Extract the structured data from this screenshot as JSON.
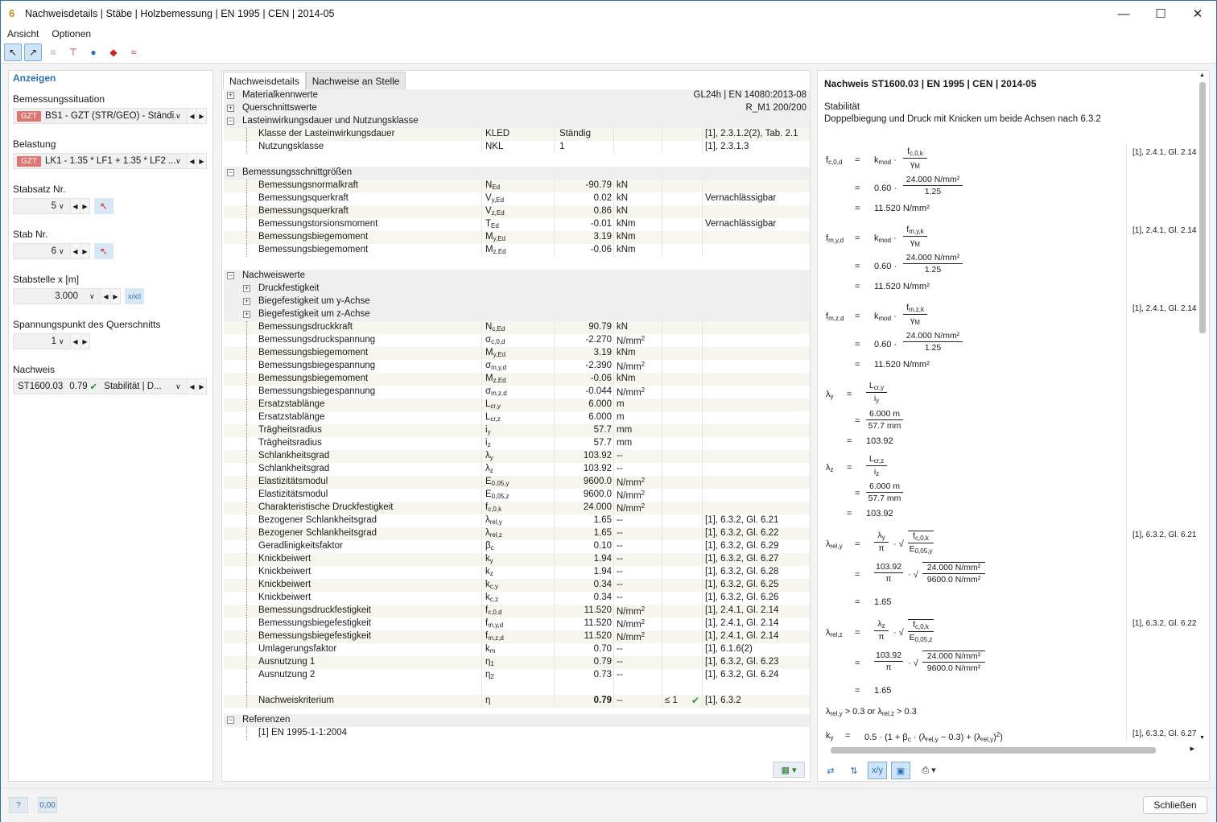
{
  "window": {
    "title": "Nachweisdetails | Stäbe | Holzbemessung | EN 1995 | CEN | 2014-05",
    "app_icon": "timber-app-icon",
    "colors": {
      "accent": "#2b6fb8",
      "gzt_badge": "#e0756f",
      "check_ok": "#1b9a3a"
    }
  },
  "menu": [
    "Ansicht",
    "Optionen"
  ],
  "left": {
    "header": "Anzeigen",
    "bemessungssituation_label": "Bemessungssituation",
    "bemessungssituation_badge": "GZT",
    "bemessungssituation_value": "BS1 - GZT (STR/GEO) - Ständi...",
    "belastung_label": "Belastung",
    "belastung_badge": "GZT",
    "belastung_value": "LK1 - 1.35 * LF1 + 1.35 * LF2 ...",
    "stabsatz_label": "Stabsatz Nr.",
    "stabsatz_value": "5",
    "stab_label": "Stab Nr.",
    "stab_value": "6",
    "stabstelle_label": "Stabstelle x [m]",
    "stabstelle_value": "3.000",
    "stabstelle_btn": "x/x",
    "spannungspunkt_label": "Spannungspunkt des Querschnitts",
    "spannungspunkt_value": "1",
    "nachweis_label": "Nachweis",
    "nachweis_id": "ST1600.03",
    "nachweis_ratio": "0.79",
    "nachweis_type": "Stabilität | D..."
  },
  "middle": {
    "tabs": [
      "Nachweisdetails",
      "Nachweise an Stelle"
    ],
    "sections": {
      "material": {
        "label": "Materialkennwerte",
        "right": "GL24h | EN 14080:2013-08"
      },
      "querschnitt": {
        "label": "Querschnittswerte",
        "right": "R_M1 200/200"
      },
      "lastdauer": {
        "label": "Lasteinwirkungsdauer und Nutzungsklasse"
      },
      "schnitt": {
        "label": "Bemessungsschnittgrößen"
      },
      "nachweiswerte": {
        "label": "Nachweiswerte"
      },
      "druckfestigkeit": {
        "label": "Druckfestigkeit"
      },
      "biege_y": {
        "label": "Biegefestigkeit um y-Achse"
      },
      "biege_z": {
        "label": "Biegefestigkeit um z-Achse"
      },
      "referenzen": {
        "label": "Referenzen"
      }
    },
    "lastdauer_rows": [
      {
        "name": "Klasse der Lasteinwirkungsdauer",
        "sym": "KLED",
        "txt": "Ständig",
        "ref": "[1], 2.3.1.2(2), Tab. 2.1"
      },
      {
        "name": "Nutzungsklasse",
        "sym": "NKL",
        "txt": "1",
        "ref": "[1], 2.3.1.3"
      }
    ],
    "schnitt_rows": [
      {
        "name": "Bemessungsnormalkraft",
        "s": "N",
        "sub": "Ed",
        "val": "-90.79",
        "unit": "kN",
        "ref": ""
      },
      {
        "name": "Bemessungsquerkraft",
        "s": "V",
        "sub": "y,Ed",
        "val": "0.02",
        "unit": "kN",
        "ref": "Vernachlässigbar"
      },
      {
        "name": "Bemessungsquerkraft",
        "s": "V",
        "sub": "z,Ed",
        "val": "0.86",
        "unit": "kN",
        "ref": ""
      },
      {
        "name": "Bemessungstorsionsmoment",
        "s": "T",
        "sub": "Ed",
        "val": "-0.01",
        "unit": "kNm",
        "ref": "Vernachlässigbar"
      },
      {
        "name": "Bemessungsbiegemoment",
        "s": "M",
        "sub": "y,Ed",
        "val": "3.19",
        "unit": "kNm",
        "ref": ""
      },
      {
        "name": "Bemessungsbiegemoment",
        "s": "M",
        "sub": "z,Ed",
        "val": "-0.06",
        "unit": "kNm",
        "ref": ""
      }
    ],
    "nachweis_rows": [
      {
        "name": "Bemessungsdruckkraft",
        "s": "N",
        "sub": "c,Ed",
        "val": "90.79",
        "unit": "kN",
        "ref": ""
      },
      {
        "name": "Bemessungsdruckspannung",
        "s": "σ",
        "sub": "c,0,d",
        "val": "-2.270",
        "unit": "N/mm²",
        "ref": ""
      },
      {
        "name": "Bemessungsbiegemoment",
        "s": "M",
        "sub": "y,Ed",
        "val": "3.19",
        "unit": "kNm",
        "ref": ""
      },
      {
        "name": "Bemessungsbiegespannung",
        "s": "σ",
        "sub": "m,y,d",
        "val": "-2.390",
        "unit": "N/mm²",
        "ref": ""
      },
      {
        "name": "Bemessungsbiegemoment",
        "s": "M",
        "sub": "z,Ed",
        "val": "-0.06",
        "unit": "kNm",
        "ref": ""
      },
      {
        "name": "Bemessungsbiegespannung",
        "s": "σ",
        "sub": "m,z,d",
        "val": "-0.044",
        "unit": "N/mm²",
        "ref": ""
      },
      {
        "name": "Ersatzstablänge",
        "s": "L",
        "sub": "cr,y",
        "val": "6.000",
        "unit": "m",
        "ref": ""
      },
      {
        "name": "Ersatzstablänge",
        "s": "L",
        "sub": "cr,z",
        "val": "6.000",
        "unit": "m",
        "ref": ""
      },
      {
        "name": "Trägheitsradius",
        "s": "i",
        "sub": "y",
        "val": "57.7",
        "unit": "mm",
        "ref": ""
      },
      {
        "name": "Trägheitsradius",
        "s": "i",
        "sub": "z",
        "val": "57.7",
        "unit": "mm",
        "ref": ""
      },
      {
        "name": "Schlankheitsgrad",
        "s": "λ",
        "sub": "y",
        "val": "103.92",
        "unit": "--",
        "ref": ""
      },
      {
        "name": "Schlankheitsgrad",
        "s": "λ",
        "sub": "z",
        "val": "103.92",
        "unit": "--",
        "ref": ""
      },
      {
        "name": "Elastizitätsmodul",
        "s": "E",
        "sub": "0,05,y",
        "val": "9600.0",
        "unit": "N/mm²",
        "ref": ""
      },
      {
        "name": "Elastizitätsmodul",
        "s": "E",
        "sub": "0,05,z",
        "val": "9600.0",
        "unit": "N/mm²",
        "ref": ""
      },
      {
        "name": "Charakteristische Druckfestigkeit",
        "s": "f",
        "sub": "c,0,k",
        "val": "24.000",
        "unit": "N/mm²",
        "ref": ""
      },
      {
        "name": "Bezogener Schlankheitsgrad",
        "s": "λ",
        "sub": "rel,y",
        "val": "1.65",
        "unit": "--",
        "ref": "[1], 6.3.2, Gl. 6.21"
      },
      {
        "name": "Bezogener Schlankheitsgrad",
        "s": "λ",
        "sub": "rel,z",
        "val": "1.65",
        "unit": "--",
        "ref": "[1], 6.3.2, Gl. 6.22"
      },
      {
        "name": "Geradlinigkeitsfaktor",
        "s": "β",
        "sub": "c",
        "val": "0.10",
        "unit": "--",
        "ref": "[1], 6.3.2, Gl. 6.29"
      },
      {
        "name": "Knickbeiwert",
        "s": "k",
        "sub": "y",
        "val": "1.94",
        "unit": "--",
        "ref": "[1], 6.3.2, Gl. 6.27"
      },
      {
        "name": "Knickbeiwert",
        "s": "k",
        "sub": "z",
        "val": "1.94",
        "unit": "--",
        "ref": "[1], 6.3.2, Gl. 6.28"
      },
      {
        "name": "Knickbeiwert",
        "s": "k",
        "sub": "c,y",
        "val": "0.34",
        "unit": "--",
        "ref": "[1], 6.3.2, Gl. 6.25"
      },
      {
        "name": "Knickbeiwert",
        "s": "k",
        "sub": "c,z",
        "val": "0.34",
        "unit": "--",
        "ref": "[1], 6.3.2, Gl. 6.26"
      },
      {
        "name": "Bemessungsdruckfestigkeit",
        "s": "f",
        "sub": "c,0,d",
        "val": "11.520",
        "unit": "N/mm²",
        "ref": "[1], 2.4.1, Gl. 2.14"
      },
      {
        "name": "Bemessungsbiegefestigkeit",
        "s": "f",
        "sub": "m,y,d",
        "val": "11.520",
        "unit": "N/mm²",
        "ref": "[1], 2.4.1, Gl. 2.14"
      },
      {
        "name": "Bemessungsbiegefestigkeit",
        "s": "f",
        "sub": "m,z,d",
        "val": "11.520",
        "unit": "N/mm²",
        "ref": "[1], 2.4.1, Gl. 2.14"
      },
      {
        "name": "Umlagerungsfaktor",
        "s": "k",
        "sub": "m",
        "val": "0.70",
        "unit": "--",
        "ref": "[1], 6.1.6(2)"
      },
      {
        "name": "Ausnutzung 1",
        "s": "η",
        "sub": "1",
        "val": "0.79",
        "unit": "--",
        "ref": "[1], 6.3.2, Gl. 6.23"
      },
      {
        "name": "Ausnutzung 2",
        "s": "η",
        "sub": "2",
        "val": "0.73",
        "unit": "--",
        "ref": "[1], 6.3.2, Gl. 6.24"
      }
    ],
    "kriterium": {
      "name": "Nachweiskriterium",
      "sym": "η",
      "val": "0.79",
      "unit": "--",
      "lim": "≤ 1",
      "ref": "[1], 6.3.2"
    },
    "referenz_row": "[1]  EN 1995-1-1:2004"
  },
  "right": {
    "title": "Nachweis ST1600.03 | EN 1995 | CEN | 2014-05",
    "subtitle1": "Stabilität",
    "subtitle2": "Doppelbiegung und Druck mit Knicken um beide Achsen nach 6.3.2",
    "ref_2_14": "[1], 2.4.1, Gl. 2.14",
    "ref_6_21": "[1], 6.3.2, Gl. 6.21",
    "ref_6_22": "[1], 6.3.2, Gl. 6.22",
    "ref_6_27": "[1], 6.3.2, Gl. 6.27",
    "v060": "0.60",
    "v24": "24.000 N/mm²",
    "v125": "1.25",
    "v1152": "11.520 N/mm²",
    "v6m": "6.000 m",
    "v577": "57.7 mm",
    "v10392": "103.92",
    "v9600": "9600.0 N/mm²",
    "v165": "1.65",
    "cond": "> 0.3 or",
    "cond2": "> 0.3",
    "ky_expr": "0.5 · (1 + β  · (λ     − 0.3) + (λ    )²)"
  },
  "footer": {
    "close": "Schließen",
    "decimals": "0,00"
  }
}
